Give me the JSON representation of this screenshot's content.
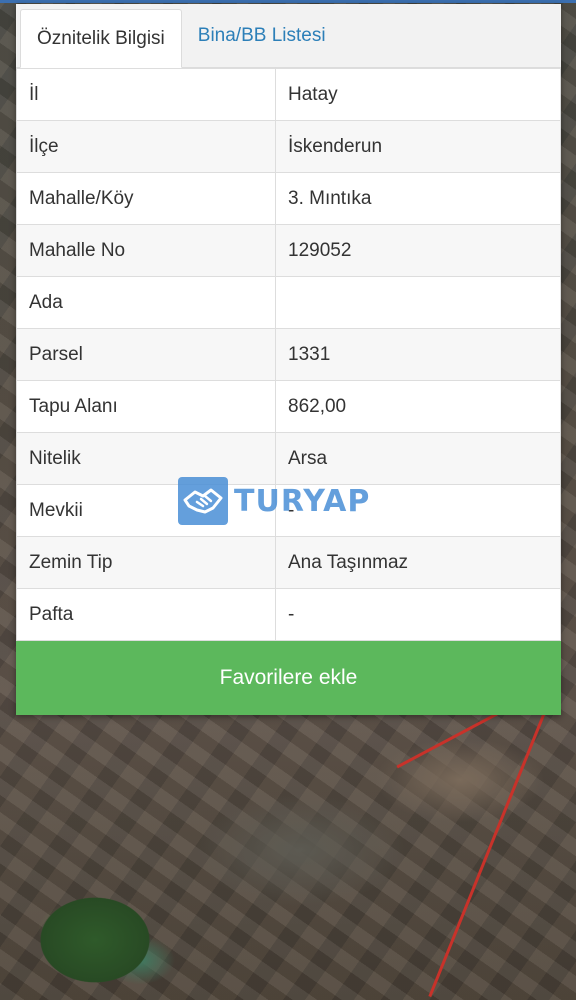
{
  "tabs": [
    {
      "label": "Öznitelik Bilgisi",
      "active": true
    },
    {
      "label": "Bina/BB Listesi",
      "active": false
    }
  ],
  "rows": [
    {
      "key": "İl",
      "value": "Hatay"
    },
    {
      "key": "İlçe",
      "value": "İskenderun"
    },
    {
      "key": "Mahalle/Köy",
      "value": "3. Mıntıka"
    },
    {
      "key": "Mahalle No",
      "value": "129052"
    },
    {
      "key": "Ada",
      "value": ""
    },
    {
      "key": "Parsel",
      "value": "1331"
    },
    {
      "key": "Tapu Alanı",
      "value": "862,00"
    },
    {
      "key": "Nitelik",
      "value": "Arsa"
    },
    {
      "key": "Mevkii",
      "value": "-"
    },
    {
      "key": "Zemin Tip",
      "value": "Ana Taşınmaz"
    },
    {
      "key": "Pafta",
      "value": "-"
    }
  ],
  "favorite_button": {
    "label": "Favorilere ekle"
  },
  "watermark": {
    "text": "TURYAP",
    "icon": "handshake-icon"
  },
  "colors": {
    "accent_blue": "#2c7fb8",
    "button_green": "#5cb85c",
    "watermark_blue": "#4a8fd6",
    "road_red": "#c8322a"
  }
}
